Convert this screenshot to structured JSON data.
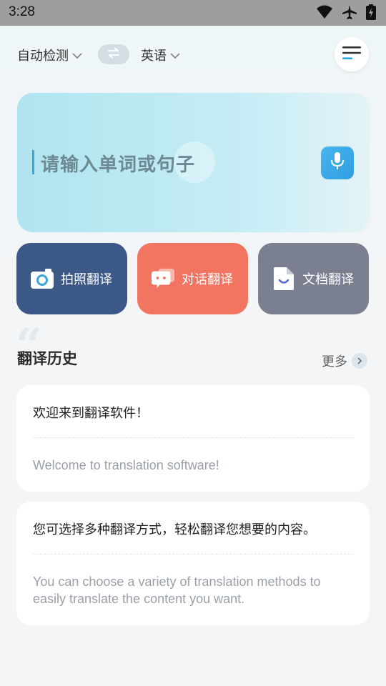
{
  "status_bar": {
    "time": "3:28",
    "icons": [
      "wifi-icon",
      "airplane-icon",
      "battery-charging-icon"
    ]
  },
  "language_bar": {
    "source_language": "自动检测",
    "target_language": "英语",
    "swap_icon": "swap-arrows-icon",
    "menu_icon": "menu-icon"
  },
  "input": {
    "placeholder": "请输入单词或句子",
    "mic_icon": "microphone-icon"
  },
  "features": [
    {
      "label": "拍照翻译",
      "icon": "camera-icon",
      "color": "#3b5886"
    },
    {
      "label": "对话翻译",
      "icon": "chat-icon",
      "color": "#f27562"
    },
    {
      "label": "文档翻译",
      "icon": "document-icon",
      "color": "#7b8090"
    }
  ],
  "history": {
    "title": "翻译历史",
    "more_label": "更多",
    "items": [
      {
        "source": "欢迎来到翻译软件！",
        "translation": "Welcome to translation software!"
      },
      {
        "source": "您可选择多种翻译方式，轻松翻译您想要的内容。",
        "translation": "You can choose a variety of translation methods to easily translate the content you want."
      }
    ]
  },
  "colors": {
    "accent": "#3aa5d6",
    "input_bg": "#b0e4f0",
    "photo_btn": "#3b5886",
    "dialog_btn": "#f27562",
    "doc_btn": "#7b8090"
  }
}
